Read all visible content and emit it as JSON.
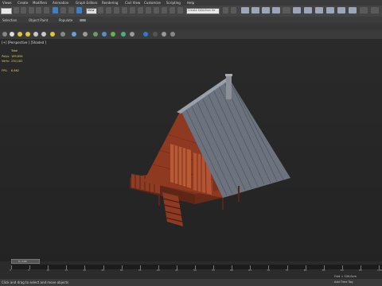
{
  "menu": [
    "Views",
    "Create",
    "Modifiers",
    "Animation",
    "Graph Editors",
    "Rendering",
    "Civil View",
    "Customize",
    "Scripting",
    "Help"
  ],
  "toolbar": {
    "view_combo": "View",
    "set_combo": "Create Selection Se"
  },
  "ribbon": {
    "tabs": [
      "Selection",
      "Object Paint",
      "Populate"
    ]
  },
  "viewport": {
    "label": "[+] [Perspective ] [Shaded ]",
    "stats": {
      "header": "Total",
      "polys_label": "Polys:",
      "polys_value": "189,856",
      "verts_label": "Verts:",
      "verts_value": "230,182",
      "fps_label": "FPS:",
      "fps_value": "6,662"
    }
  },
  "timeline": {
    "slider_label": "0 / 100",
    "ticks": [
      "0",
      "5",
      "10",
      "15",
      "20",
      "25",
      "30",
      "35",
      "40",
      "45",
      "50",
      "55",
      "60",
      "65",
      "70",
      "75",
      "80",
      "85",
      "90",
      "95",
      "100"
    ]
  },
  "status": {
    "message": "Click and drag to select and move objects",
    "grid": "Grid = 100,0cm",
    "add_time_tag": "Add Time Tag"
  },
  "colors": {
    "wood": "#8a3a22",
    "roof": "#6e7480",
    "accent_blue": "#3f7fc6"
  }
}
